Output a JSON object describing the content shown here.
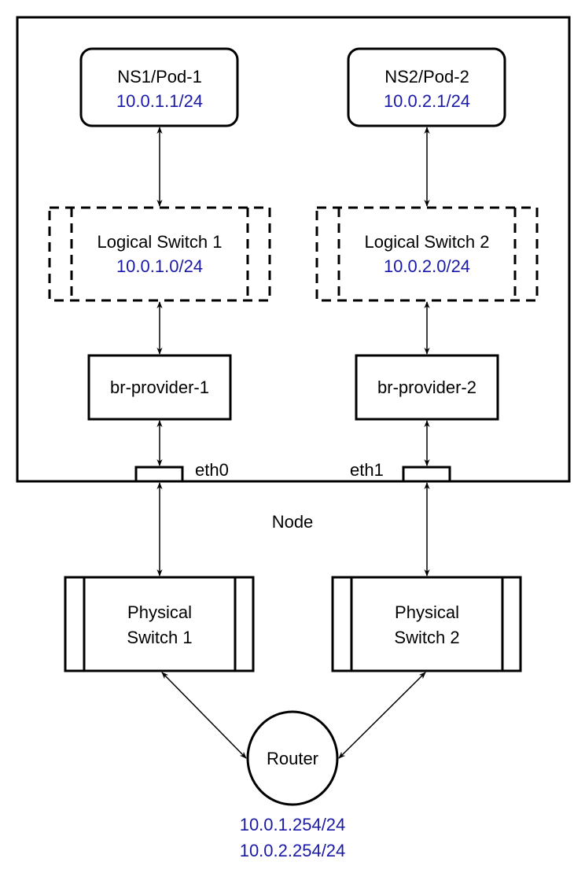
{
  "colors": {
    "ip": "#1a1aa6",
    "line": "#000000"
  },
  "node": {
    "label": "Node"
  },
  "pods": [
    {
      "name": "NS1/Pod-1",
      "ip": "10.0.1.1/24"
    },
    {
      "name": "NS2/Pod-2",
      "ip": "10.0.2.1/24"
    }
  ],
  "logical_switches": [
    {
      "name": "Logical Switch 1",
      "subnet": "10.0.1.0/24"
    },
    {
      "name": "Logical Switch 2",
      "subnet": "10.0.2.0/24"
    }
  ],
  "bridges": [
    {
      "name": "br-provider-1"
    },
    {
      "name": "br-provider-2"
    }
  ],
  "interfaces": [
    {
      "name": "eth0"
    },
    {
      "name": "eth1"
    }
  ],
  "physical_switches": [
    {
      "line1": "Physical",
      "line2": "Switch 1"
    },
    {
      "line1": "Physical",
      "line2": "Switch 2"
    }
  ],
  "router": {
    "name": "Router",
    "ips": [
      "10.0.1.254/24",
      "10.0.2.254/24"
    ]
  }
}
